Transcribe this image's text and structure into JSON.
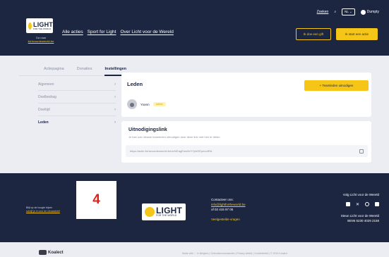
{
  "header": {
    "logo_text": "LIGHT",
    "logo_subtext": "FOR THE WORLD",
    "go_to_label": "Ga naar",
    "go_to_link": "lichtvoordewereld.be",
    "nav": [
      "Alle acties",
      "Sport for Light",
      "Over Licht voor de Wereld"
    ],
    "search_label": "Zoeken",
    "language": "NL",
    "user_name": "Dumpty",
    "gift_button": "Ik doe een gift",
    "start_button": "Ik start een actie"
  },
  "tabs": [
    "Actiepagina",
    "Donaties",
    "Instellingen"
  ],
  "sidebar": {
    "items": [
      {
        "label": "Algemeen"
      },
      {
        "label": "Doelbedrag"
      },
      {
        "label": "Doeltijd"
      },
      {
        "label": "Leden"
      }
    ]
  },
  "members_card": {
    "title": "Leden",
    "invite_button": "+ Teamleden uitnodigen",
    "member_name": "Yoann",
    "member_badge": "Admin"
  },
  "invite_card": {
    "title": "Uitnodigingslink",
    "description": "Je kan ook nieuwe teamleden uitnodigen door deze link met hen te delen.",
    "link": "https://actie.lichtvoordewereld.be/a/h/EagEms0eYYphGEpmu4RA"
  },
  "overlay_number": "4",
  "footer": {
    "left_text": "Blijf op de hoogte bijven",
    "left_link": "schrijf je in voor de nieuwsbrief",
    "contact_title": "Contacteer ons:",
    "contact_email": "info@lightfortheworld.be",
    "contact_phone": "of 02 415 97 05",
    "faq": "Veelgestelde vragen",
    "follow": "Volg Licht voor de Wereld",
    "support_title": "Steun Licht voor de Wereld",
    "iban": "BE95 5230 4029 2158"
  },
  "bottom": {
    "brand": "Koalect",
    "links": "Made with ♡ in Belgium  |  Gebruiksvoorwaarden  |  Privacy beleid  |  Cookiebeleid  |  © 2024 Koalect"
  },
  "colors": {
    "navy": "#1c2641",
    "accent": "#f5c518",
    "background": "#ecedf2",
    "overlay_number": "#e0201b"
  }
}
